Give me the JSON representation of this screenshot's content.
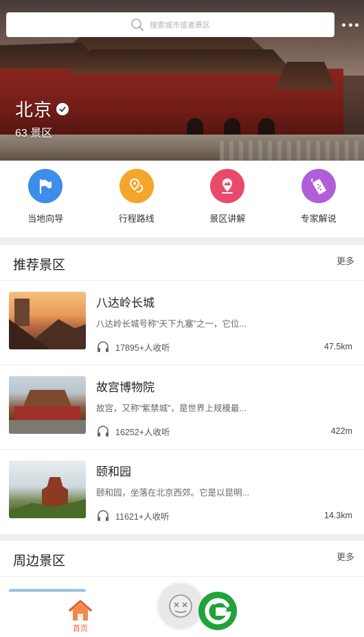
{
  "header": {
    "search_placeholder": "搜索城市或者景区",
    "city": "北京",
    "spot_count": "63 景区"
  },
  "quick_menu": [
    {
      "label": "当地向导",
      "icon": "flag-icon",
      "color": "#3d8ee8"
    },
    {
      "label": "行程路线",
      "icon": "route-pin-icon",
      "color": "#f4a62a"
    },
    {
      "label": "景区讲解",
      "icon": "mountain-pin-icon",
      "color": "#ea4a6a"
    },
    {
      "label": "专家解说",
      "icon": "audio-device-icon",
      "color": "#b05fd8"
    }
  ],
  "recommended": {
    "title": "推荐景区",
    "more": "更多",
    "items": [
      {
        "title": "八达岭长城",
        "desc": "八达岭长城号称“天下九塞”之一，它位...",
        "listeners": "17895+人收听",
        "distance": "47.5km"
      },
      {
        "title": "故宫博物院",
        "desc": "故宫，又称“紫禁城”，是世界上规模最...",
        "listeners": "16252+人收听",
        "distance": "422m"
      },
      {
        "title": "颐和园",
        "desc": "颐和园，坐落在北京西郊。它是以昆明...",
        "listeners": "11621+人收听",
        "distance": "14.3km"
      }
    ]
  },
  "nearby": {
    "title": "周边景区",
    "more": "更多"
  },
  "tabbar": {
    "home_label": "首页"
  },
  "colors": {
    "accent": "#e7632c",
    "brand_green": "#1fa33a"
  }
}
